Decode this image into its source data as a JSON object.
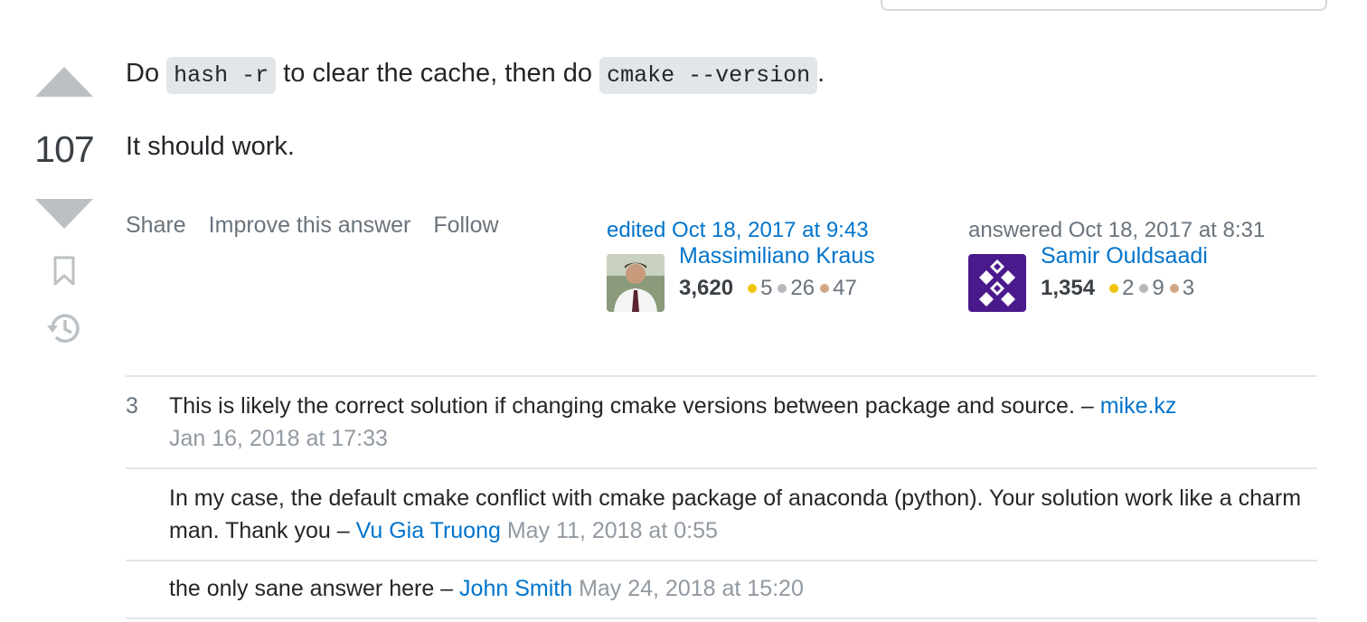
{
  "vote": {
    "count": "107"
  },
  "answer": {
    "line1_pre": "Do ",
    "code1": "hash -r",
    "line1_mid": " to clear the cache, then do ",
    "code2": "cmake --version",
    "line1_post": ".",
    "line2": "It should work."
  },
  "menu": {
    "share": "Share",
    "improve": "Improve this answer",
    "follow": "Follow"
  },
  "editor": {
    "label": "edited Oct 18, 2017 at 9:43",
    "name": "Massimiliano Kraus",
    "rep": "3,620",
    "gold": "5",
    "silver": "26",
    "bronze": "47"
  },
  "author": {
    "label": "answered Oct 18, 2017 at 8:31",
    "name": "Samir Ouldsaadi",
    "rep": "1,354",
    "gold": "2",
    "silver": "9",
    "bronze": "3"
  },
  "comments": [
    {
      "score": "3",
      "text": "This is likely the correct solution if changing cmake versions between package and source. – ",
      "user": "mike.kz",
      "date": "Jan 16, 2018 at 17:33"
    },
    {
      "score": "",
      "text": "In my case, the default cmake conflict with cmake package of anaconda (python). Your solution work like a charm man. Thank you – ",
      "user": "Vu Gia Truong",
      "date": "May 11, 2018 at 0:55"
    },
    {
      "score": "",
      "text": "the only sane answer here – ",
      "user": "John Smith",
      "date": "May 24, 2018 at 15:20"
    }
  ],
  "colors": {
    "link": "#0074cc",
    "muted": "#6a737c",
    "arrow": "#bbc0c4"
  }
}
